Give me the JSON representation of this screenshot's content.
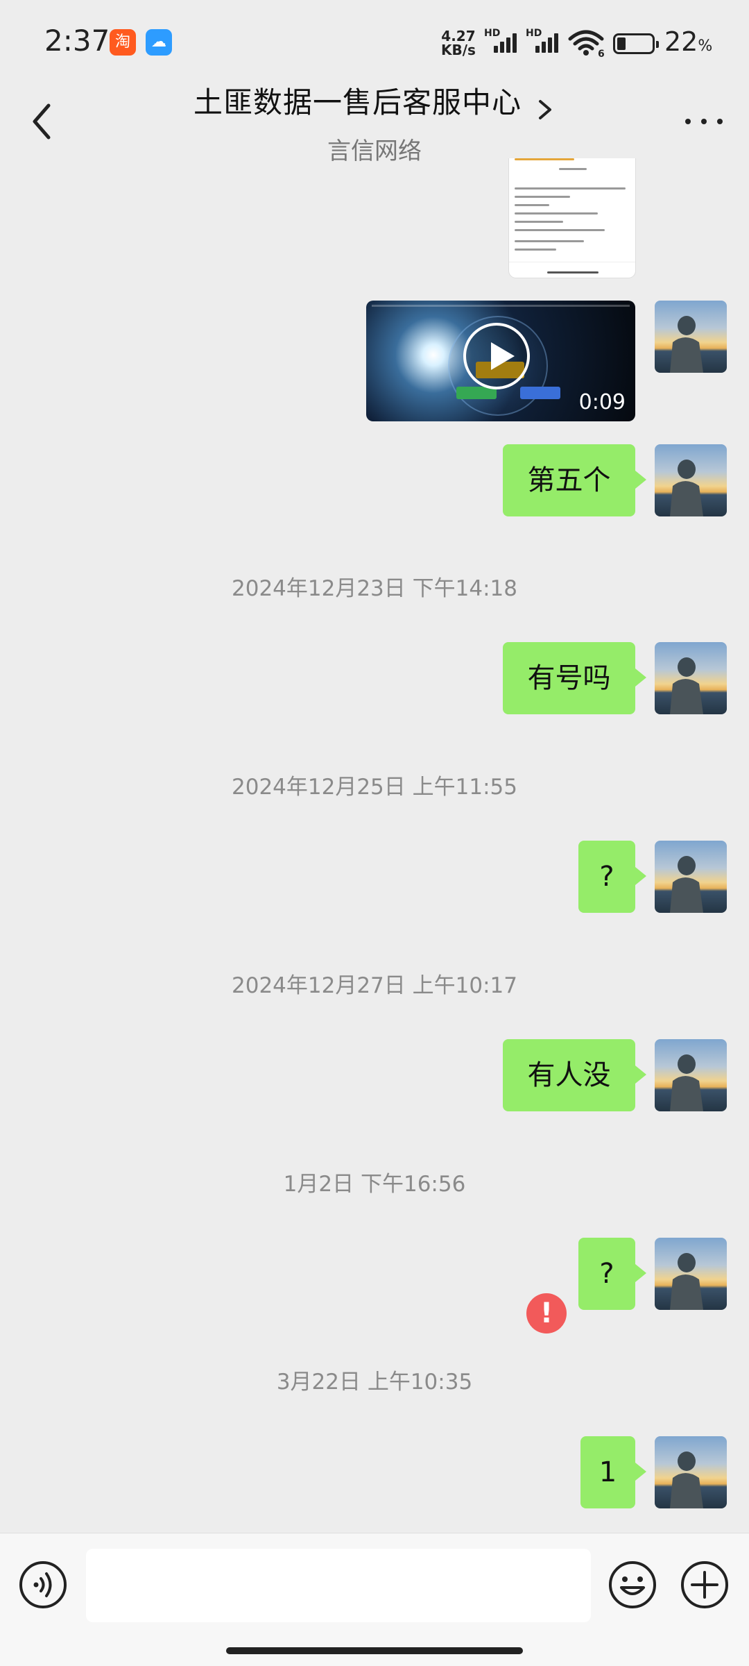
{
  "status_bar": {
    "time": "2:37",
    "network_speed_value": "4.27",
    "network_speed_unit": "KB/s",
    "hd_label_1": "HD",
    "hd_label_2": "HD",
    "wifi_badge": "6",
    "battery_percent": "22",
    "battery_unit": "%",
    "app_icons": [
      "taobao-icon",
      "cloud-icon"
    ]
  },
  "header": {
    "title": "土匪数据一售后客服中心",
    "subtitle": "言信网络",
    "back_icon": "chevron-left-icon",
    "more_icon": "more-dots-icon"
  },
  "messages": [
    {
      "type": "image",
      "sender": "self"
    },
    {
      "type": "video",
      "sender": "self",
      "duration": "0:09"
    },
    {
      "type": "text",
      "sender": "self",
      "text": "第五个"
    },
    {
      "type": "timestamp",
      "text": "2024年12月23日 下午14:18"
    },
    {
      "type": "text",
      "sender": "self",
      "text": "有号吗"
    },
    {
      "type": "timestamp",
      "text": "2024年12月25日 上午11:55"
    },
    {
      "type": "text",
      "sender": "self",
      "text": "?"
    },
    {
      "type": "timestamp",
      "text": "2024年12月27日 上午10:17"
    },
    {
      "type": "text",
      "sender": "self",
      "text": "有人没"
    },
    {
      "type": "timestamp",
      "text": "1月2日 下午16:56"
    },
    {
      "type": "text",
      "sender": "self",
      "text": "?"
    },
    {
      "type": "timestamp",
      "text": "3月22日 上午10:35"
    },
    {
      "type": "text",
      "sender": "self",
      "text": "1",
      "error": true
    }
  ],
  "error_mark": "!",
  "input_bar": {
    "value": "",
    "voice_icon": "voice-icon",
    "emoji_icon": "emoji-icon",
    "plus_icon": "plus-icon"
  },
  "colors": {
    "background": "#ededed",
    "bubble_self": "#95ec69",
    "error": "#f25a5a",
    "timestamp_text": "#8a8a8a"
  }
}
